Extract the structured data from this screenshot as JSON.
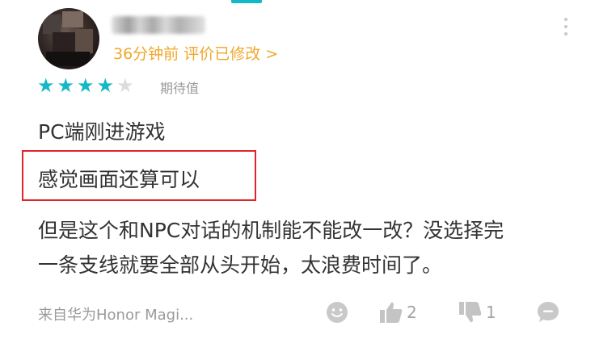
{
  "review": {
    "username": "",
    "meta": "36分钟前 评价已修改 >",
    "rating": {
      "value": 4,
      "max": 5,
      "label": "期待值"
    },
    "lines": [
      "PC端刚进游戏",
      "感觉画面还算可以",
      "但是这个和NPC对话的机制能不能改一改？没选择完",
      "一条支线就要全部从头开始，太浪费时间了。"
    ],
    "source": "来自华为Honor Magi...",
    "likes": "2",
    "dislikes": "1"
  },
  "icons": {
    "more": "more-vertical-icon",
    "emoji": "emoji-icon",
    "like": "thumbs-up-icon",
    "dislike": "thumbs-down-icon",
    "comment": "comment-icon"
  },
  "colors": {
    "accent": "#14b9c8",
    "meta": "#f0a72a",
    "highlight": "#e0242a"
  }
}
